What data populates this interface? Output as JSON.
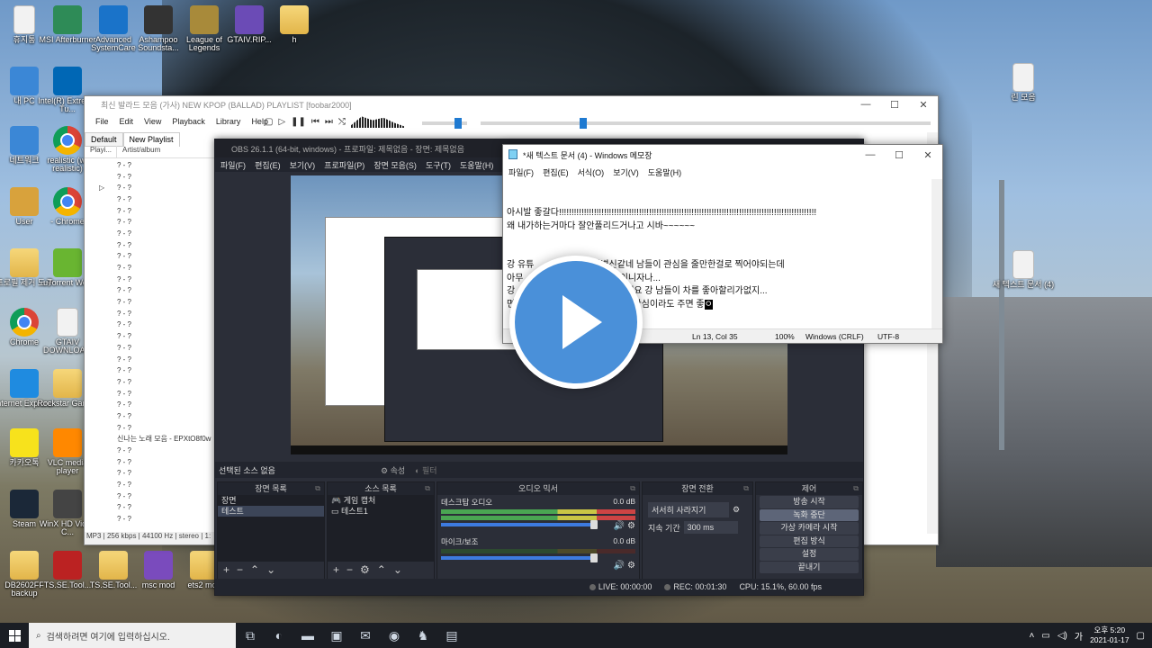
{
  "desktop": {
    "icons": [
      {
        "label": "휴지통",
        "kind": "doc"
      },
      {
        "label": "MSI Afterburner",
        "kind": "app",
        "color": "#2e8b57"
      },
      {
        "label": "Advanced SystemCare",
        "kind": "app",
        "color": "#1a73c9"
      },
      {
        "label": "Ashampoo Soundsta...",
        "kind": "app",
        "color": "#333"
      },
      {
        "label": "League of Legends",
        "kind": "app",
        "color": "#a88a3a"
      },
      {
        "label": "GTAIV.RIP...",
        "kind": "app",
        "color": "#6b4bb6"
      },
      {
        "label": "h",
        "kind": "folder"
      },
      {
        "label": "내 PC",
        "kind": "app",
        "color": "#3b87d6"
      },
      {
        "label": "Intel(R) Extreme Tu...",
        "kind": "app",
        "color": "#0067b5"
      },
      {
        "label": "네트워크",
        "kind": "app",
        "color": "#3b87d6"
      },
      {
        "label": "realistic (w/ realistic)",
        "kind": "chrome"
      },
      {
        "label": "User",
        "kind": "app",
        "color": "#d8a23c"
      },
      {
        "label": "- Chrome",
        "kind": "chrome"
      },
      {
        "label": "프로필 제거 도구",
        "kind": "folder"
      },
      {
        "label": "uTorrent Web",
        "kind": "app",
        "color": "#69b531"
      },
      {
        "label": "Chrome",
        "kind": "chrome"
      },
      {
        "label": "GTAIV DOWNLOA...",
        "kind": "doc"
      },
      {
        "label": "Internet Explorer",
        "kind": "app",
        "color": "#1f8be0"
      },
      {
        "label": "Rockstar Games",
        "kind": "folder"
      },
      {
        "label": "카카오톡",
        "kind": "app",
        "color": "#f7e21c"
      },
      {
        "label": "VLC media player",
        "kind": "app",
        "color": "#ff8800"
      },
      {
        "label": "Steam",
        "kind": "app",
        "color": "#1b2838"
      },
      {
        "label": "WinX HD Video C...",
        "kind": "app",
        "color": "#444"
      },
      {
        "label": "DB2602FF backup",
        "kind": "folder"
      },
      {
        "label": "TS.SE.Tool...",
        "kind": "app",
        "color": "#b22"
      },
      {
        "label": "TS.SE.Tool...",
        "kind": "folder"
      },
      {
        "label": "msc mod",
        "kind": "app",
        "color": "#7a4bbd"
      },
      {
        "label": "ets2 mod",
        "kind": "folder"
      },
      {
        "label": "린 모음",
        "kind": "doc"
      },
      {
        "label": "새 텍스트 문서 (4)",
        "kind": "doc"
      }
    ]
  },
  "foobar": {
    "title": "최신 발라드 모음 (가사) NEW KPOP (BALLAD) PLAYLIST [foobar2000]",
    "menu": [
      "File",
      "Edit",
      "View",
      "Playback",
      "Library",
      "Help"
    ],
    "tabs": [
      "Default",
      "New Playlist"
    ],
    "columns": [
      "Playi...",
      "Artist/album"
    ],
    "rows": [
      "? - ?",
      "? - ?",
      "? - ?",
      "? - ?",
      "? - ?",
      "? - ?",
      "? - ?",
      "? - ?",
      "? - ?",
      "? - ?",
      "? - ?",
      "? - ?",
      "? - ?",
      "? - ?",
      "? - ?",
      "? - ?",
      "? - ?",
      "? - ?",
      "? - ?",
      "? - ?",
      "? - ?",
      "? - ?",
      "? - ?",
      "? - ?",
      "신나는 노래 모음 - EPXtO8f0w",
      "? - ?",
      "? - ?",
      "? - ?",
      "? - ?",
      "? - ?",
      "? - ?",
      "? - ?"
    ],
    "playing_row": 2,
    "status": "MP3 | 256 kbps | 44100 Hz | stereo | 1:"
  },
  "obs": {
    "title": "OBS 26.1.1 (64-bit, windows) - 프로파일: 제목없음 - 장면: 제목없음",
    "menu": [
      "파일(F)",
      "편집(E)",
      "보기(V)",
      "프로파일(P)",
      "장면 모음(S)",
      "도구(T)",
      "도움말(H)"
    ],
    "selected_source": "선택된 소스 없음",
    "properties": "속성",
    "filters": "필터",
    "scenes": {
      "header": "장면 목록",
      "items": [
        "장면",
        "테스트"
      ]
    },
    "sources": {
      "header": "소스 목록",
      "items": [
        "게임 캡처",
        "테스트1"
      ]
    },
    "mixer": {
      "header": "오디오 믹서",
      "channels": [
        {
          "name": "데스크탑 오디오",
          "db": "0.0 dB",
          "active": true
        },
        {
          "name": "마이크/보조",
          "db": "0.0 dB",
          "active": false
        }
      ]
    },
    "transitions": {
      "header": "장면 전환",
      "type": "서서히 사라지기",
      "duration_label": "지속 기간",
      "duration": "300 ms"
    },
    "controls": {
      "header": "제어",
      "buttons": [
        "방송 시작",
        "녹화 중단",
        "가상 카메라 시작",
        "편집 방식",
        "설정",
        "끝내기"
      ],
      "active_button": 1
    },
    "status": {
      "live": "LIVE: 00:00:00",
      "rec": "REC: 00:01:30",
      "cpu": "CPU: 15.1%, 60.00 fps"
    }
  },
  "notepad": {
    "title": "*새 텍스트 문서 (4) - Windows 메모장",
    "menu": [
      "파일(F)",
      "편집(E)",
      "서식(O)",
      "보기(V)",
      "도움말(H)"
    ],
    "lines": [
      "",
      "",
      "아시발 좋갈다!!!!!!!!!!!!!!!!!!!!!!!!!!!!!!!!!!!!!!!!!!!!!!!!!!!!!!!!!!!!!!!!!!!!!!!!!!!!!!!!!!!!!!!!!!!!!!!!!!!!!!!",
      "왜 내가하는거마다 잘안풀리드거나고 시바~~~~~~",
      "",
      "",
      "강 유튜                   좀 나병신같네 남들이 관심을 줄만한걸로 찍어야되는데",
      "아무                               ㅇ건 이니자나...",
      "강                              니다 ㅈ같네요 강 남들이 차를 좋아할리가없지...",
      "면                                라도 남이 관심이라도 주면 좋"
    ],
    "cursor_char": "ㅇ",
    "status": {
      "position": "Ln 13, Col 35",
      "zoom": "100%",
      "eol": "Windows (CRLF)",
      "encoding": "UTF-8"
    }
  },
  "taskbar": {
    "search_placeholder": "검색하려면 여기에 입력하십시오.",
    "time": "오후 5:20",
    "date": "2021-01-17",
    "ime": "가"
  }
}
